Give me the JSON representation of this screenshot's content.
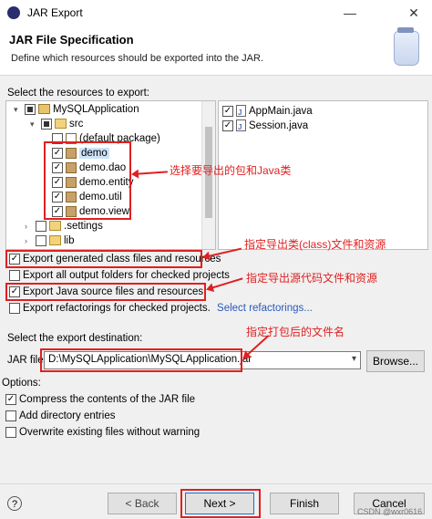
{
  "window": {
    "title": "JAR Export",
    "min": "—",
    "close": "✕"
  },
  "header": {
    "title": "JAR File Specification",
    "description": "Define which resources should be exported into the JAR."
  },
  "resources": {
    "label": "Select the resources to export:",
    "tree": [
      {
        "text": "MySQLApplication",
        "state": "partial",
        "expander": "▾"
      },
      {
        "text": "src",
        "state": "partial",
        "expander": "▾"
      },
      {
        "text": "(default package)",
        "state": "unchecked",
        "expander": ""
      },
      {
        "text": "demo",
        "state": "checked",
        "expander": ""
      },
      {
        "text": "demo.dao",
        "state": "checked",
        "expander": ""
      },
      {
        "text": "demo.entity",
        "state": "checked",
        "expander": ""
      },
      {
        "text": "demo.util",
        "state": "checked",
        "expander": ""
      },
      {
        "text": "demo.view",
        "state": "checked",
        "expander": ""
      },
      {
        "text": ".settings",
        "state": "unchecked",
        "expander": "›"
      },
      {
        "text": "lib",
        "state": "unchecked",
        "expander": "›"
      }
    ],
    "files": [
      {
        "text": "AppMain.java",
        "state": "checked"
      },
      {
        "text": "Session.java",
        "state": "checked"
      }
    ]
  },
  "export_options": [
    {
      "text": "Export generated class files and resources",
      "state": "checked"
    },
    {
      "text": "Export all output folders for checked projects",
      "state": "unchecked"
    },
    {
      "text": "Export Java source files and resources",
      "state": "checked"
    },
    {
      "text": "Export refactorings for checked projects.",
      "state": "unchecked"
    }
  ],
  "select_refactorings": "Select refactorings...",
  "destination": {
    "label": "Select the export destination:",
    "jar_label": "JAR file:",
    "jar_value": "D:\\MySQLApplication\\MySQLApplication.jar",
    "browse": "Browse..."
  },
  "options": {
    "label": "Options:",
    "items": [
      {
        "text": "Compress the contents of the JAR file",
        "state": "checked"
      },
      {
        "text": "Add directory entries",
        "state": "unchecked"
      },
      {
        "text": "Overwrite existing files without warning",
        "state": "unchecked"
      }
    ]
  },
  "annotations": {
    "select_packages": "选择要导出的包和Java类",
    "export_class": "指定导出类(class)文件和资源",
    "export_source": "指定导出源代码文件和资源",
    "jar_name": "指定打包后的文件名"
  },
  "buttons": {
    "help": "?",
    "back": "< Back",
    "next": "Next >",
    "finish": "Finish",
    "cancel": "Cancel"
  },
  "watermark": "CSDN @wxr0616"
}
